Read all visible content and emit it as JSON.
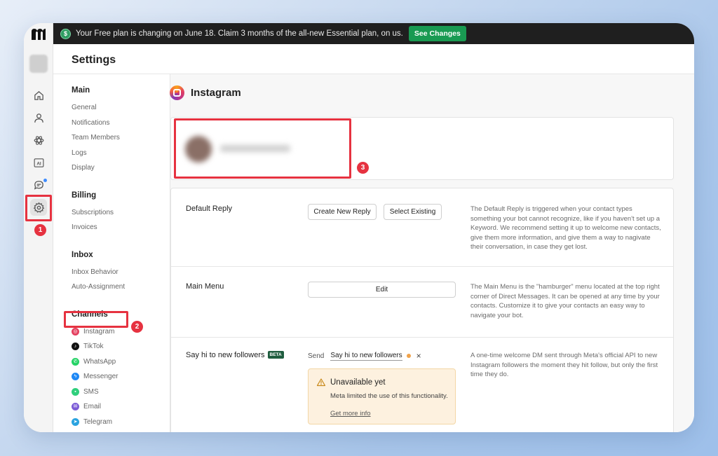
{
  "banner": {
    "coin_symbol": "$",
    "text": "Your Free plan is changing on June 18. Claim 3 months of the all-new Essential plan, on us.",
    "button": "See Changes"
  },
  "rail": {
    "icons": [
      "home-icon",
      "contacts-icon",
      "automation-icon",
      "ai-icon",
      "chat-icon",
      "settings-icon"
    ],
    "ai_label": "AI"
  },
  "settings": {
    "title": "Settings",
    "groups": [
      {
        "title": "Main",
        "items": [
          "General",
          "Notifications",
          "Team Members",
          "Logs",
          "Display"
        ]
      },
      {
        "title": "Billing",
        "items": [
          "Subscriptions",
          "Invoices"
        ]
      },
      {
        "title": "Inbox",
        "items": [
          "Inbox Behavior",
          "Auto-Assignment"
        ]
      },
      {
        "title": "Channels",
        "items": [
          "Instagram",
          "TikTok",
          "WhatsApp",
          "Messenger",
          "SMS",
          "Email",
          "Telegram"
        ]
      }
    ]
  },
  "page": {
    "title": "Instagram",
    "default_reply": {
      "label": "Default Reply",
      "create_button": "Create New Reply",
      "select_button": "Select Existing",
      "description": "The Default Reply is triggered when your contact types something your bot cannot recognize, like if you haven't set up a Keyword. We recommend setting it up to welcome new contacts, give them more information, and give them a way to nagivate their conversation, in case they get lost."
    },
    "main_menu": {
      "label": "Main Menu",
      "edit_button": "Edit",
      "description": "The Main Menu is the \"hamburger\" menu located at the top right corner of Direct Messages. It can be opened at any time by your contacts. Customize it to give your contacts an easy way to navigate your bot."
    },
    "followers": {
      "label": "Say hi to new followers",
      "beta": "BETA",
      "send_label": "Send",
      "send_value": "Say hi to new followers",
      "close": "×",
      "description": "A one-time welcome DM sent through Meta's official API to new Instagram followers the moment they hit follow, but only the first time they do.",
      "warning_title": "Unavailable yet",
      "warning_text": "Meta limited the use of this functionality.",
      "warning_link": "Get more info"
    }
  },
  "annotations": [
    "1",
    "2",
    "3"
  ],
  "colors": {
    "highlight": "#e63240",
    "banner_bg": "#1f1f1f",
    "banner_button": "#199a52",
    "warning_bg": "#fdf1df"
  }
}
